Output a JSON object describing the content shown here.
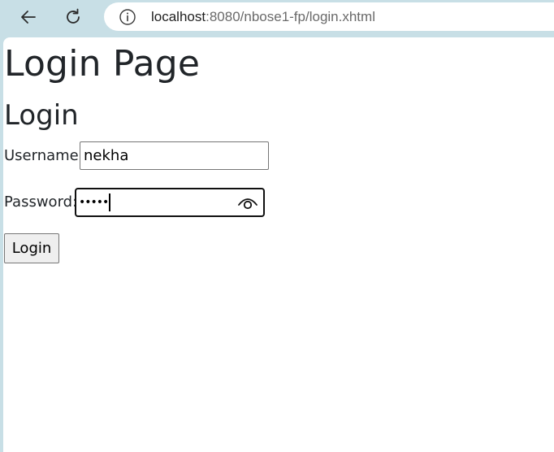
{
  "browser": {
    "url_host": "localhost",
    "url_rest": ":8080/nbose1-fp/login.xhtml"
  },
  "page": {
    "title": "Login Page",
    "form_heading": "Login",
    "username_label": "Username:",
    "username_value": "nekha",
    "password_label": "Password:",
    "password_masked": "•••••",
    "login_button": "Login"
  },
  "icons": {
    "back": "back-arrow-icon",
    "reload": "reload-icon",
    "info": "info-icon",
    "reveal_password": "eye-icon"
  }
}
